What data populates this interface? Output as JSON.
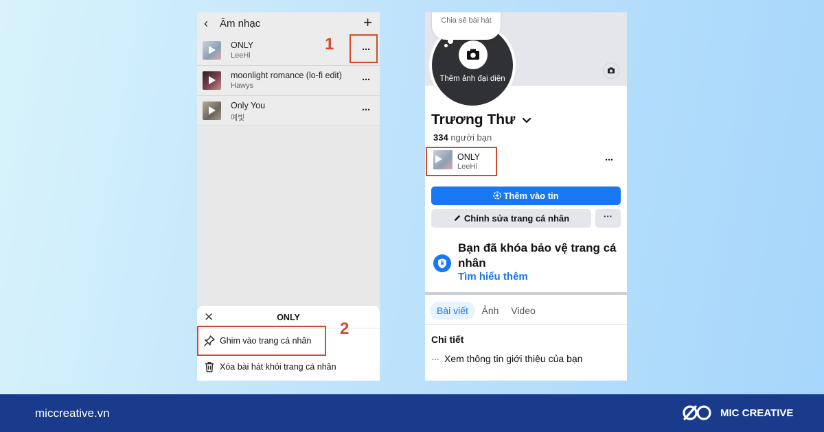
{
  "music_list": {
    "back_icon": "chevron-left-icon",
    "title": "Âm nhạc",
    "add_icon": "plus-icon",
    "more_icon": "more-horizontal-icon",
    "songs": [
      {
        "title": "ONLY",
        "artist": "LeeHi",
        "thumb_color": "#a8b6c7"
      },
      {
        "title": "moonlight romance (lo-fi edit)",
        "artist": "Hawys",
        "thumb_color": "#5e3a3f"
      },
      {
        "title": "Only You",
        "artist": "예빛",
        "thumb_color": "#8d8479"
      }
    ]
  },
  "action_sheet": {
    "close_icon": "close-icon",
    "title": "ONLY",
    "items": [
      {
        "icon": "pin-icon",
        "label": "Ghim vào trang cá nhân"
      },
      {
        "icon": "trash-icon",
        "label": "Xóa bài hát khỏi trang cá nhân"
      }
    ]
  },
  "steps": {
    "step1": "1",
    "step2": "2"
  },
  "profile": {
    "bubble_text": "Chia sẻ bài hát",
    "avatar_text": "Thêm ảnh đại diện",
    "name": "Trương Thư",
    "friends_count": "334",
    "friends_label": "người bạn",
    "pinned_song": {
      "title": "ONLY",
      "artist": "LeeHi"
    },
    "add_story_label": "Thêm vào tin",
    "edit_profile_label": "Chỉnh sửa trang cá nhân",
    "more_label": "···",
    "lock_title": "Bạn đã khóa bảo vệ trang cá nhân",
    "lock_link": "Tìm hiểu thêm",
    "tabs": [
      "Bài viết",
      "Ảnh",
      "Video"
    ],
    "details_title": "Chi tiết",
    "details_row": "Xem thông tin giới thiệu của bạn"
  },
  "footer": {
    "url": "miccreative.vn",
    "brand": "MIC CREATIVE",
    "logo_icon": "mic-creative-logo"
  },
  "colors": {
    "highlight": "#d24a2c",
    "facebook_blue": "#1877f2",
    "footer_bg": "#1a3a8c"
  }
}
